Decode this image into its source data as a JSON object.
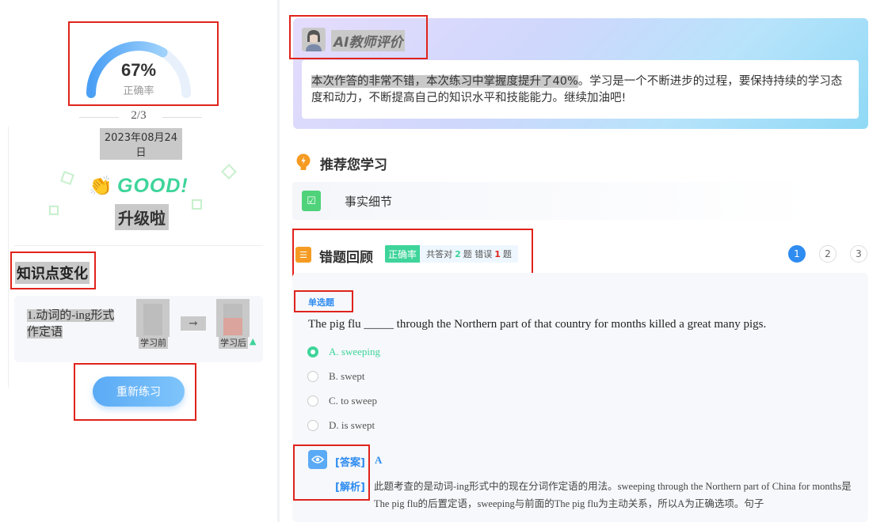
{
  "summary": {
    "accuracy_pct": "67%",
    "accuracy_value": 0.67,
    "accuracy_label": "正确率",
    "progress": "2/3",
    "date": "2023年08月24日"
  },
  "badge": {
    "good_text": "GOOD!",
    "upgrade_text": "升级啦"
  },
  "knowledge": {
    "title": "知识点变化",
    "item_name": "1.动词的-ing形式作定语",
    "before_label": "学习前",
    "after_label": "学习后",
    "retry_label": "重新练习"
  },
  "ai_eval": {
    "title": "AI教师评价",
    "text_highlight": "本次作答的非常不错，本次练习中掌握度提升了40%",
    "text_rest": "。学习是一个不断进步的过程，要保持持续的学习态度和动力，不断提高自己的知识水平和技能能力。继续加油吧!"
  },
  "recommend": {
    "title": "推荐您学习",
    "item_label": "事实细节"
  },
  "review": {
    "title": "错题回顾",
    "acc_tag": "正确率",
    "stat_prefix": "共答对",
    "correct_count": "2",
    "stat_mid": "题 错误",
    "wrong_count": "1",
    "stat_suffix": "题",
    "pages": [
      "1",
      "2",
      "3"
    ],
    "active_page": "1"
  },
  "question": {
    "type": "单选题",
    "stem": "The pig flu _____ through the Northern part of that country for months killed a great many pigs.",
    "options": [
      "A. sweeping",
      "B. swept",
      "C. to sweep",
      "D. is swept"
    ],
    "selected_index": 0,
    "answer_label": "[答案]",
    "answer_value": "A",
    "explain_label": "[解析]",
    "explain_text": "此题考查的是动词-ing形式中的现在分词作定语的用法。sweeping through the Northern part of China for months是The pig flu的后置定语，sweeping与前面的The pig flu为主动关系，所以A为正确选项。句子"
  },
  "colors": {
    "accent_blue": "#2f8cf0",
    "accent_green": "#3ed49a",
    "annotation_red": "#e0231c"
  }
}
